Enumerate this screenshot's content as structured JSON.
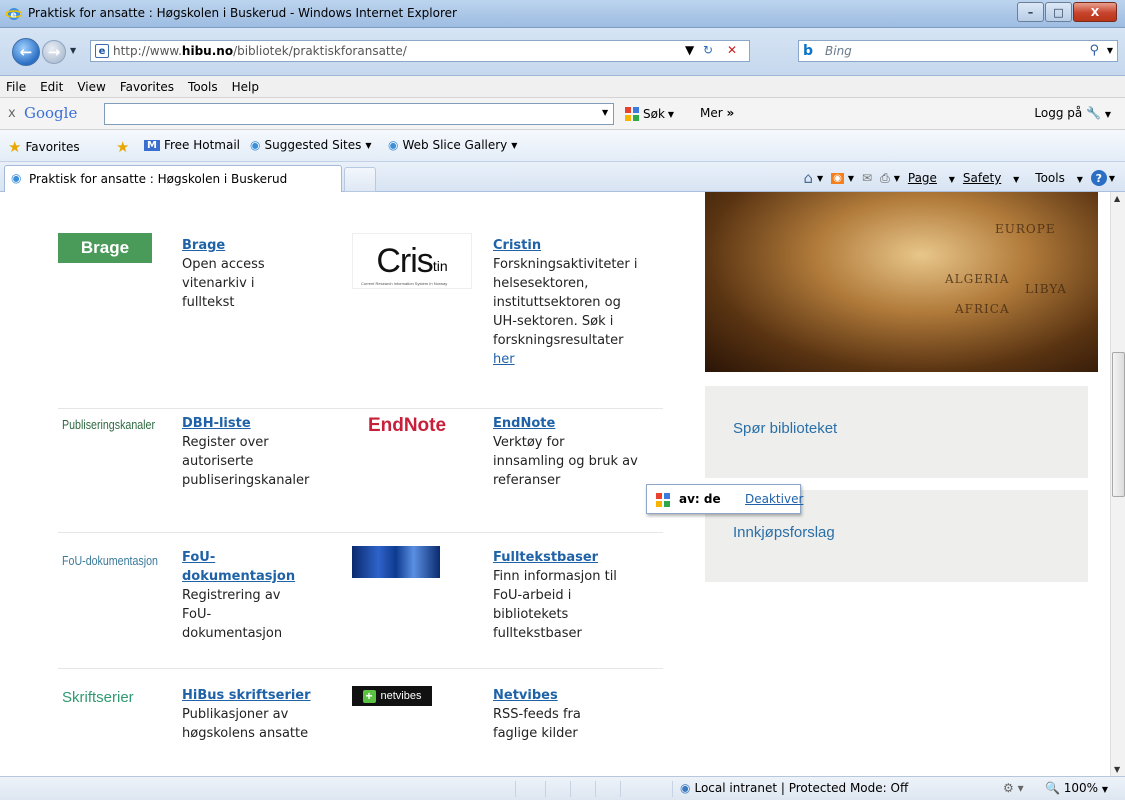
{
  "window": {
    "title": "Praktisk for ansatte : Høgskolen i Buskerud - Windows Internet Explorer",
    "minimize": "–",
    "maximize": "□",
    "close": "X"
  },
  "address": {
    "url_prefix": "http://www.",
    "url_domain": "hibu.no",
    "url_path": "/bibliotek/praktiskforansatte/",
    "search_placeholder": "Bing"
  },
  "menu": [
    "File",
    "Edit",
    "View",
    "Favorites",
    "Tools",
    "Help"
  ],
  "google_bar": {
    "close": "x",
    "logo": "Google",
    "search_label": "Søk",
    "more_label": "Mer",
    "more_arrows": "»",
    "login_label": "Logg på"
  },
  "favorites_bar": {
    "favorites": "Favorites",
    "hotmail": "Free Hotmail",
    "suggested": "Suggested Sites",
    "webslice": "Web Slice Gallery"
  },
  "tab": {
    "title": "Praktisk for ansatte : Høgskolen i Buskerud"
  },
  "command_bar": {
    "page": "Page",
    "safety": "Safety",
    "tools": "Tools"
  },
  "content": {
    "entries": [
      {
        "title": "Brage",
        "desc": [
          "Open access",
          "vitenarkiv i",
          "fulltekst"
        ]
      },
      {
        "title": "Cristin",
        "desc": [
          "Forskningsaktiviteter i",
          "helsesektoren,",
          "instituttsektoren og",
          "UH-sektoren. Søk i",
          "forskningsresultater"
        ],
        "link": "her"
      },
      {
        "title": "DBH-liste",
        "desc": [
          "Register over",
          "autoriserte",
          "publiseringskanaler"
        ]
      },
      {
        "title": "EndNote",
        "desc": [
          "Verktøy for",
          "innsamling og bruk av",
          "referanser"
        ]
      },
      {
        "title_lines": [
          "FoU-",
          "dokumentasjon"
        ],
        "desc": [
          "Registrering av",
          "FoU-",
          "dokumentasjon"
        ]
      },
      {
        "title": "Fulltekstbaser",
        "desc": [
          "Finn informasjon til",
          "FoU-arbeid i",
          "bibliotekets",
          "fulltekstbaser"
        ]
      },
      {
        "title": "HiBus skriftserier",
        "desc": [
          "Publikasjoner av",
          "høgskolens ansatte"
        ]
      },
      {
        "title": "Netvibes",
        "desc": [
          "RSS-feeds fra",
          "faglige kilder"
        ]
      }
    ],
    "logos": {
      "brage": "Brage",
      "cristin_main": "Cris",
      "cristin_tin": "tin",
      "cristin_sub": "Current Research Information System In Norway",
      "publiseringskanaler": "Publiseringskanaler",
      "endnote": "EndNote",
      "fou": "FoU-dokumentasjon",
      "skriftserier": "Skriftserier",
      "netvibes": "netvibes",
      "netvibes_plus": "+"
    },
    "globe_labels": [
      "EUROPE",
      "AFRICA",
      "LIBYA",
      "ALGERIA"
    ],
    "panels": [
      "Spør biblioteket",
      "Innkjøpsforslag"
    ],
    "popup": {
      "label": "av: de",
      "action": "Deaktiver"
    }
  },
  "status_bar": {
    "zone": "Local intranet | Protected Mode: Off",
    "zoom": "100%"
  }
}
